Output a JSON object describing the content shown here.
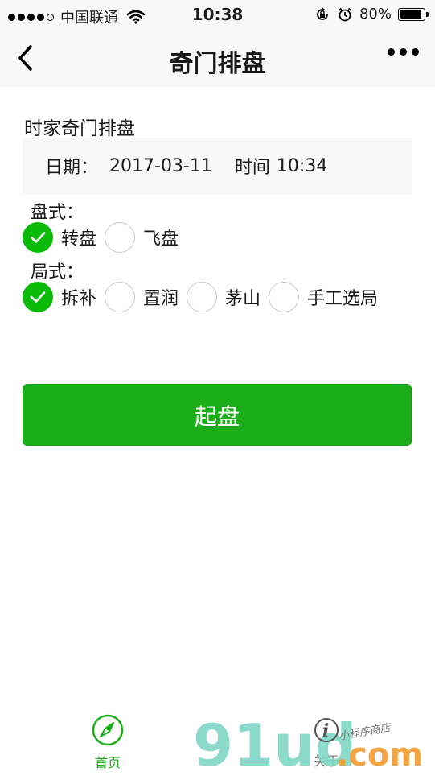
{
  "status_bar": {
    "carrier": "中国联通",
    "time": "10:38",
    "battery": "80%",
    "icons": [
      "signal-dots-icon",
      "wifi-icon",
      "rotation-lock-icon",
      "alarm-icon",
      "battery-icon"
    ]
  },
  "nav": {
    "title": "奇门排盘",
    "back_icon": "chevron-left-icon",
    "more_icon": "more-dots-icon"
  },
  "form": {
    "section_title": "时家奇门排盘",
    "date_label": "日期：",
    "date_value": "2017-03-11",
    "time_label": "时间",
    "time_value": "10:34",
    "pan_label": "盘式：",
    "pan_options": [
      {
        "label": "转盘",
        "checked": true
      },
      {
        "label": "飞盘",
        "checked": false
      }
    ],
    "ju_label": "局式：",
    "ju_options": [
      {
        "label": "拆补",
        "checked": true
      },
      {
        "label": "置润",
        "checked": false
      },
      {
        "label": "茅山",
        "checked": false
      },
      {
        "label": "手工选局",
        "checked": false
      }
    ],
    "submit_label": "起盘"
  },
  "tabbar": {
    "items": [
      {
        "label": "首页",
        "icon": "compass-icon",
        "active": true
      },
      {
        "label": "关于",
        "icon": "about-icon",
        "active": false
      }
    ]
  },
  "watermark": {
    "main": "91ud",
    "domain": ".com",
    "tagline": "小程序商店"
  },
  "colors": {
    "accent": "#1aad19",
    "radio_checked": "#09bb07",
    "nav_bg": "#f8f8f8"
  }
}
